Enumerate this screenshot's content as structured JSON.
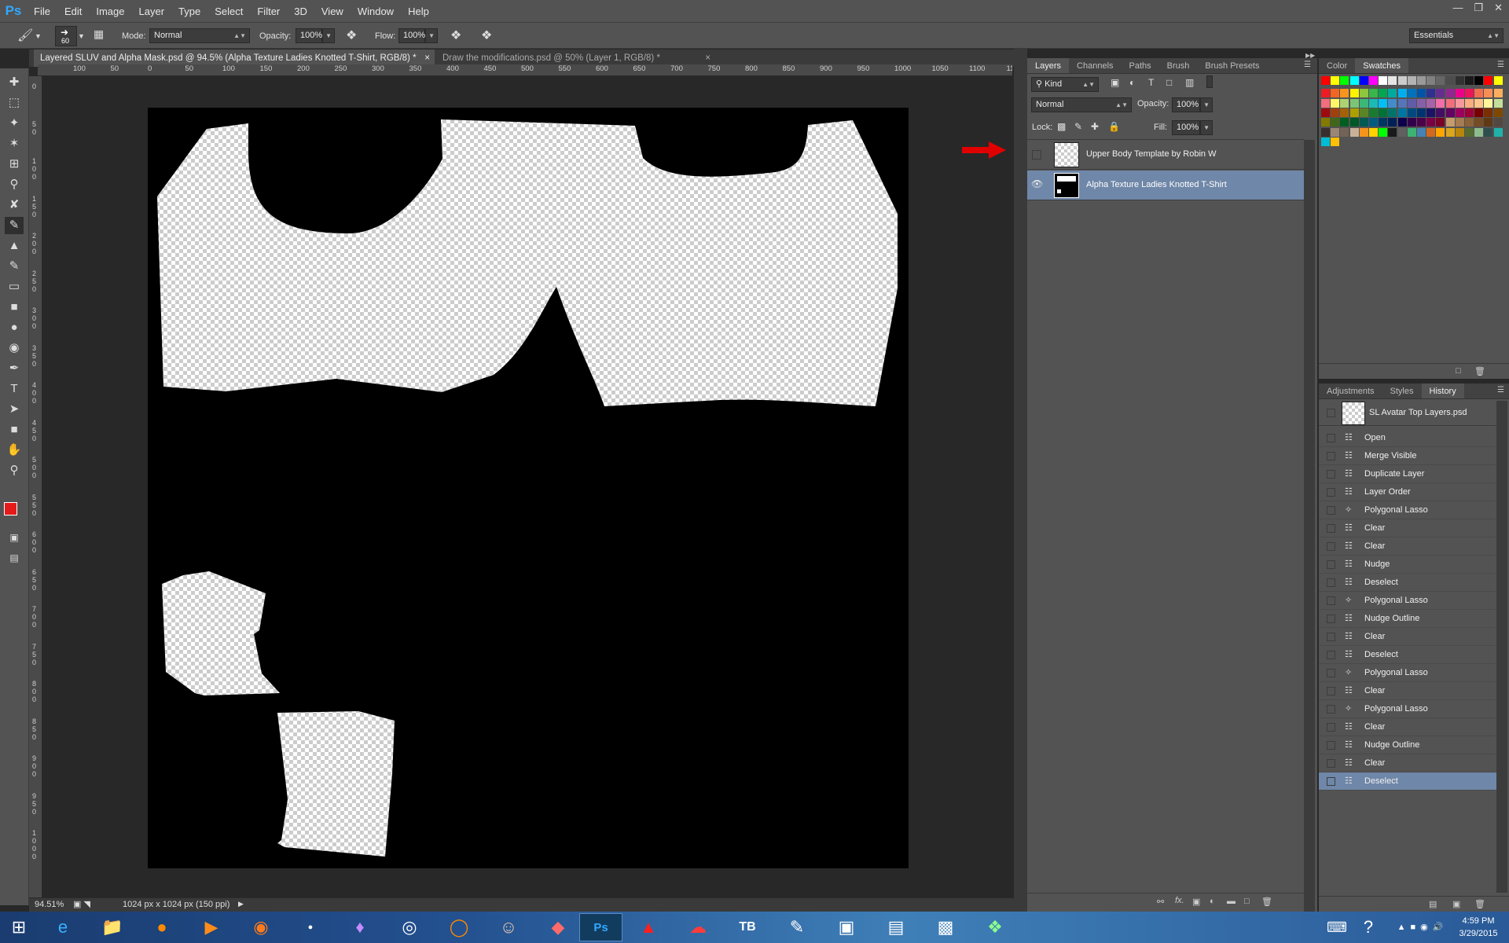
{
  "app": {
    "logo": "Ps"
  },
  "menu": [
    "File",
    "Edit",
    "Image",
    "Layer",
    "Type",
    "Select",
    "Filter",
    "3D",
    "View",
    "Window",
    "Help"
  ],
  "options": {
    "brush_size": "60",
    "mode_label": "Mode:",
    "mode_value": "Normal",
    "opacity_label": "Opacity:",
    "opacity_value": "100%",
    "flow_label": "Flow:",
    "flow_value": "100%",
    "workspace": "Essentials"
  },
  "tabs": [
    {
      "label": "Layered SLUV and Alpha Mask.psd @ 94.5% (Alpha Texture Ladies Knotted T-Shirt, RGB/8) *",
      "active": true
    },
    {
      "label": "Draw the modifications.psd @ 50% (Layer 1, RGB/8) *",
      "active": false
    }
  ],
  "ruler": {
    "top": [
      "100",
      "50",
      "0",
      "50",
      "100",
      "150",
      "200",
      "250",
      "300",
      "350",
      "400",
      "450",
      "500",
      "550",
      "600",
      "650",
      "700",
      "750",
      "800",
      "850",
      "900",
      "950",
      "1000",
      "1050",
      "1100",
      "11"
    ],
    "left": [
      "0",
      "5 0",
      "1 0 0",
      "1 5 0",
      "2 0 0",
      "2 5 0",
      "3 0 0",
      "3 5 0",
      "4 0 0",
      "4 5 0",
      "5 0 0",
      "5 5 0",
      "6 0 0",
      "6 5 0",
      "7 0 0",
      "7 5 0",
      "8 0 0",
      "8 5 0",
      "9 0 0",
      "9 5 0",
      "1 0 0 0"
    ]
  },
  "status": {
    "zoom": "94.51%",
    "doc_info": "1024 px x 1024 px (150 ppi)"
  },
  "layers_panel": {
    "tabs": [
      "Layers",
      "Channels",
      "Paths",
      "Brush",
      "Brush Presets"
    ],
    "kind": "Kind",
    "blend": "Normal",
    "opacity_label": "Opacity:",
    "opacity_value": "100%",
    "lock_label": "Lock:",
    "fill_label": "Fill:",
    "fill_value": "100%",
    "layers": [
      {
        "name": "Upper Body Template by Robin W",
        "visible": false,
        "selected": false
      },
      {
        "name": "Alpha Texture Ladies Knotted T-Shirt",
        "visible": true,
        "selected": true
      }
    ]
  },
  "swatches_panel": {
    "tabs": [
      "Color",
      "Swatches"
    ]
  },
  "history_panel": {
    "tabs": [
      "Adjustments",
      "Styles",
      "History"
    ],
    "snapshot": "SL Avatar Top Layers.psd",
    "items": [
      "Open",
      "Merge Visible",
      "Duplicate Layer",
      "Layer Order",
      "Polygonal Lasso",
      "Clear",
      "Clear",
      "Nudge",
      "Deselect",
      "Polygonal Lasso",
      "Nudge Outline",
      "Clear",
      "Deselect",
      "Polygonal Lasso",
      "Clear",
      "Polygonal Lasso",
      "Clear",
      "Nudge Outline",
      "Clear",
      "Deselect"
    ],
    "selected_index": 19
  },
  "clock": {
    "time": "4:59 PM",
    "date": "3/29/2015"
  },
  "colors": {
    "accent": "#6f87a8",
    "foreground": "#e31b1b",
    "arrow": "#e00000"
  }
}
